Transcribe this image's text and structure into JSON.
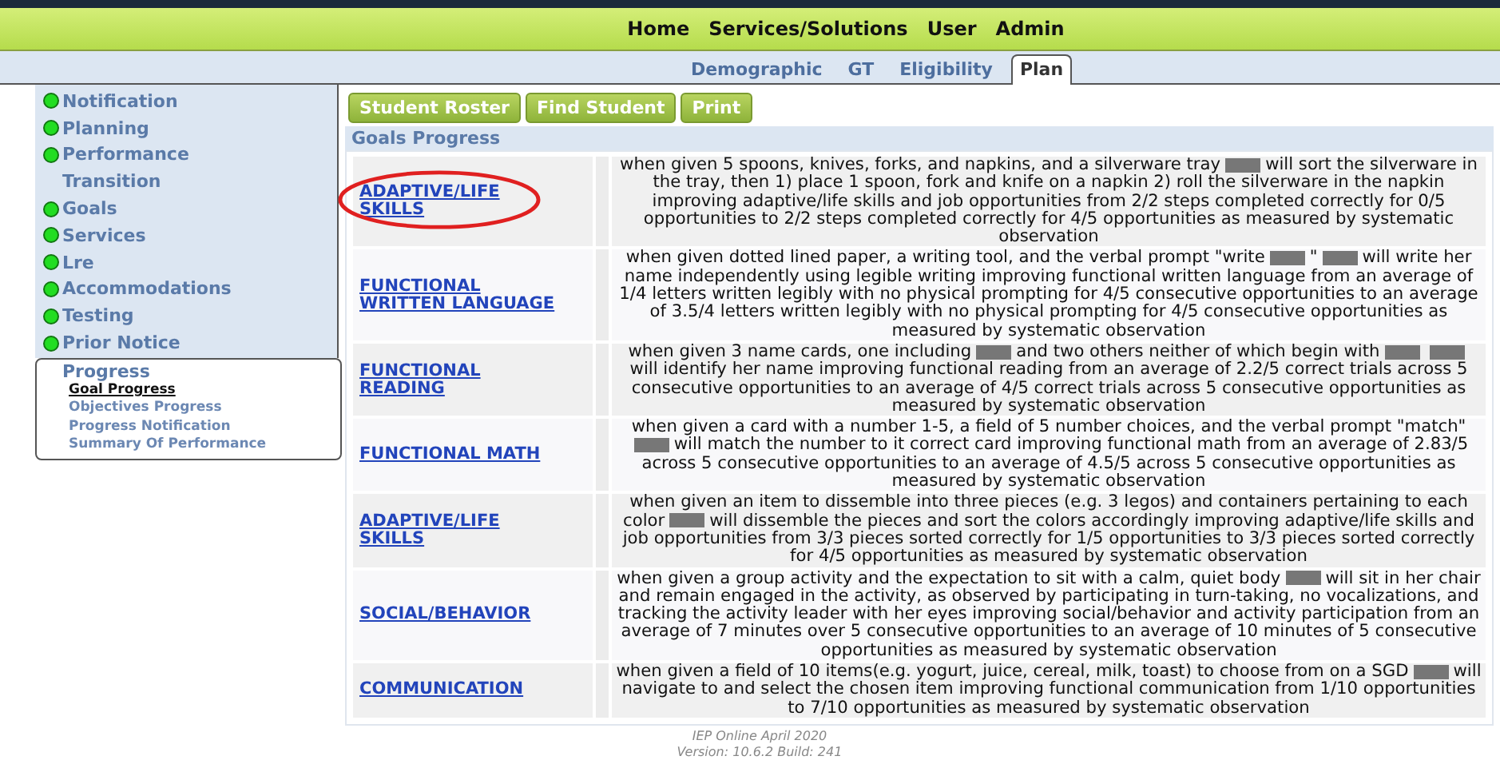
{
  "top_menu": [
    {
      "label": "Home"
    },
    {
      "label": "Services/Solutions"
    },
    {
      "label": "User"
    },
    {
      "label": "Admin"
    }
  ],
  "tabs": [
    {
      "label": "Demographic",
      "selected": false
    },
    {
      "label": "GT",
      "selected": false
    },
    {
      "label": "Eligibility",
      "selected": false
    },
    {
      "label": "Plan",
      "selected": true
    }
  ],
  "sidebar": {
    "items": [
      {
        "label": "Notification",
        "dot": true
      },
      {
        "label": "Planning",
        "dot": true
      },
      {
        "label": "Performance",
        "dot": true
      },
      {
        "label": "Transition",
        "dot": false
      },
      {
        "label": "Goals",
        "dot": true
      },
      {
        "label": "Services",
        "dot": true
      },
      {
        "label": "Lre",
        "dot": true
      },
      {
        "label": "Accommodations",
        "dot": true
      },
      {
        "label": "Testing",
        "dot": true
      },
      {
        "label": "Prior Notice",
        "dot": true
      }
    ],
    "submenu": {
      "title": "Progress",
      "items": [
        {
          "label": "Goal Progress",
          "selected": true
        },
        {
          "label": "Objectives Progress",
          "selected": false
        },
        {
          "label": "Progress Notification",
          "selected": false
        },
        {
          "label": "Summary Of Performance",
          "selected": false
        }
      ]
    }
  },
  "buttons": [
    "Student Roster",
    "Find Student",
    "Print"
  ],
  "section_title": "Goals Progress",
  "goals": [
    {
      "area": "ADAPTIVE/LIFE SKILLS",
      "highlighted": true,
      "parts": [
        {
          "kind": "text",
          "text": "when given 5 spoons, knives, forks, and napkins, and a silverware tray"
        },
        {
          "kind": "redaction"
        },
        {
          "kind": "text",
          "text": "will sort the silverware in the tray, then 1) place 1 spoon, fork and knife on a napkin 2) roll the silverware in the napkin improving adaptive/life skills and job opportunities from 2/2 steps completed correctly for 0/5 opportunities to 2/2 steps completed correctly for 4/5 opportunities as measured by systematic observation"
        }
      ]
    },
    {
      "area": "FUNCTIONAL WRITTEN LANGUAGE",
      "highlighted": false,
      "parts": [
        {
          "kind": "text",
          "text": "when given dotted lined paper, a writing tool, and the verbal prompt \"write"
        },
        {
          "kind": "redaction"
        },
        {
          "kind": "text",
          "text": "\""
        },
        {
          "kind": "redaction"
        },
        {
          "kind": "text",
          "text": "will write her name independently using legible writing improving functional written language from an average of 1/4 letters written legibly with no physical prompting for 4/5 consecutive opportunities to an average of 3.5/4 letters written legibly with no physical prompting for 4/5 consecutive opportunities as measured by systematic observation"
        }
      ]
    },
    {
      "area": "FUNCTIONAL READING",
      "highlighted": false,
      "parts": [
        {
          "kind": "text",
          "text": "when given 3 name cards, one including"
        },
        {
          "kind": "redaction"
        },
        {
          "kind": "text",
          "text": "and two others neither of which begin with"
        },
        {
          "kind": "redaction"
        },
        {
          "kind": "redaction"
        },
        {
          "kind": "text",
          "text": "will identify her name improving functional reading from an average of 2.2/5 correct trials across 5 consecutive opportunities to an average of 4/5 correct trials across 5 consecutive opportunities as measured by systematic observation"
        }
      ]
    },
    {
      "area": "FUNCTIONAL MATH",
      "highlighted": false,
      "parts": [
        {
          "kind": "text",
          "text": "when given a card with a number 1-5, a field of 5 number choices, and the verbal prompt \"match\""
        },
        {
          "kind": "redaction"
        },
        {
          "kind": "text",
          "text": "will match the number to it correct card improving functional math from an average of 2.83/5 across 5 consecutive opportunities to an average of 4.5/5 across 5 consecutive opportunities as measured by systematic observation"
        }
      ]
    },
    {
      "area": "ADAPTIVE/LIFE SKILLS",
      "highlighted": false,
      "parts": [
        {
          "kind": "text",
          "text": "when given an item to dissemble into three pieces (e.g. 3 legos) and containers pertaining to each color"
        },
        {
          "kind": "redaction"
        },
        {
          "kind": "text",
          "text": "will dissemble the pieces and sort the colors accordingly improving adaptive/life skills and job opportunities from 3/3 pieces sorted correctly for 1/5 opportunities to 3/3 pieces sorted correctly for 4/5 opportunities as measured by systematic observation"
        }
      ]
    },
    {
      "area": "SOCIAL/BEHAVIOR",
      "highlighted": false,
      "parts": [
        {
          "kind": "text",
          "text": "when given a group activity and the expectation to sit with a calm, quiet body"
        },
        {
          "kind": "redaction"
        },
        {
          "kind": "text",
          "text": "will sit in her chair and remain engaged in the activity, as observed by participating in turn-taking, no vocalizations, and tracking the activity leader with her eyes improving social/behavior and activity participation from an average of 7 minutes over 5 consecutive opportunities to an average of 10 minutes of 5 consecutive opportunities as measured by systematic observation"
        }
      ]
    },
    {
      "area": "COMMUNICATION",
      "highlighted": false,
      "parts": [
        {
          "kind": "text",
          "text": "when given a field of 10 items(e.g. yogurt, juice, cereal, milk, toast) to choose from on a SGD"
        },
        {
          "kind": "redaction"
        },
        {
          "kind": "text",
          "text": "will navigate to and select the chosen item improving functional communication from 1/10 opportunities to 7/10 opportunities as measured by systematic observation"
        }
      ]
    }
  ],
  "footer": [
    "IEP Online April 2020",
    "Version: 10.6.2 Build: 241"
  ]
}
